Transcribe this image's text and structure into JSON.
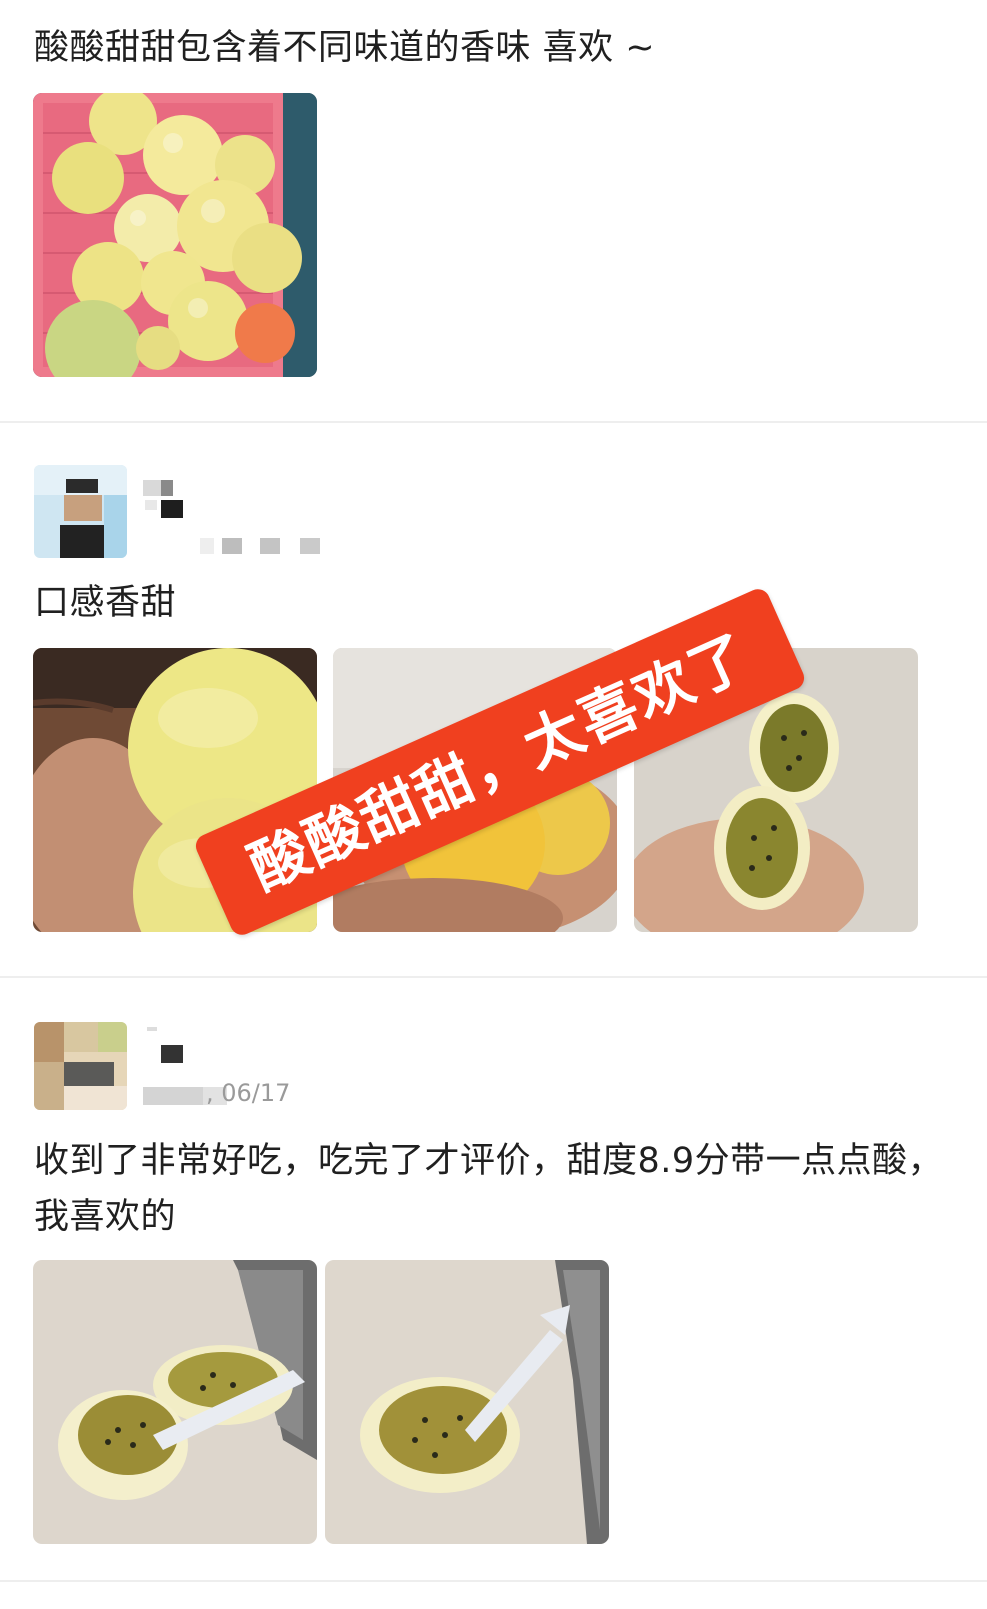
{
  "reviews": [
    {
      "text": "酸酸甜甜包含着不同味道的香味 喜欢 ~",
      "photos": [
        "passion-fruit-basket-photo"
      ]
    },
    {
      "text": "口感香甜",
      "sticker": "酸酸甜甜，太喜欢了",
      "photos": [
        "fruit-in-hand-photo",
        "two-fruits-in-hand-photo",
        "cut-fruit-in-hand-photo"
      ]
    },
    {
      "meta": ", 06/17",
      "text": "收到了非常好吃，吃完了才评价，甜度8.9分带一点点酸，我喜欢的",
      "photos": [
        "cut-fruit-with-spoon-photo-1",
        "cut-fruit-with-spoon-photo-2"
      ]
    }
  ],
  "colors": {
    "sticker_bg": "#f0401f",
    "divider": "#eeeeee",
    "text": "#202020",
    "meta": "#9a9a9a"
  }
}
